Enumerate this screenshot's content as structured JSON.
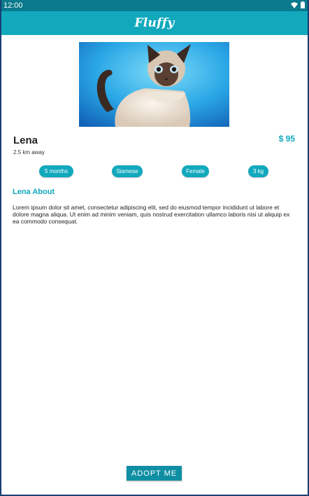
{
  "status_bar": {
    "time": "12:00",
    "icons": [
      "wifi-icon",
      "battery-icon"
    ]
  },
  "app_bar": {
    "title": "Fluffy"
  },
  "pet": {
    "image": "siamese-cat-photo",
    "name": "Lena",
    "distance": "2.5 km away",
    "price": "$ 95",
    "chips": [
      "5 months",
      "Siamese",
      "Female",
      "3 kg"
    ]
  },
  "about": {
    "title": "Lena About",
    "text": "Lorem ipsum dolor sit amet, consectetur adipiscing elit, sed do eiusmod tempor incididunt ut labore et dolore magna aliqua. Ut enim ad minim veniam, quis nostrud exercitation ullamco laboris nisi ut aliquip ex ea commodo consequat."
  },
  "actions": {
    "adopt_label": "ADOPT ME"
  },
  "colors": {
    "primary": "#12a9bd",
    "status_bar": "#0a7a8c",
    "frame": "#1a3f73"
  }
}
